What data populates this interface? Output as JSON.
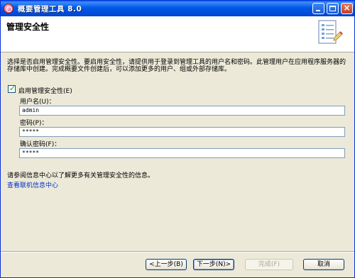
{
  "window": {
    "title": "概要管理工具 8.0",
    "icon": "profile-tool-icon"
  },
  "banner": {
    "title": "管理安全性",
    "image": "wizard-document-icon"
  },
  "content": {
    "description": "选择是否启用管理安全性。要启用安全性，请提供用于登录到管理工具的用户名和密码。此管理用户在应用程序服务器的存储库中创建。完成概要文件创建后，可以添加更多的用户、组或外部存储库。",
    "enable_checkbox": {
      "label": "启用管理安全性(E)",
      "checked": true
    },
    "username": {
      "label": "用户名(U)：",
      "value": "admin"
    },
    "password": {
      "label": "密码(P)：",
      "value": "*****"
    },
    "confirm_password": {
      "label": "确认密码(F)：",
      "value": "*****"
    },
    "info_text": "请参阅信息中心以了解更多有关管理安全性的信息。",
    "link_text": "查看联机信息中心"
  },
  "buttons": {
    "back": "<上一步(B)",
    "next": "下一步(N)>",
    "finish": "完成(F)",
    "cancel": "取消"
  },
  "colors": {
    "titlebar": "#0058e6",
    "dialog_bg": "#ece9d8",
    "link": "#0033cc",
    "checkmark": "#21a121"
  }
}
